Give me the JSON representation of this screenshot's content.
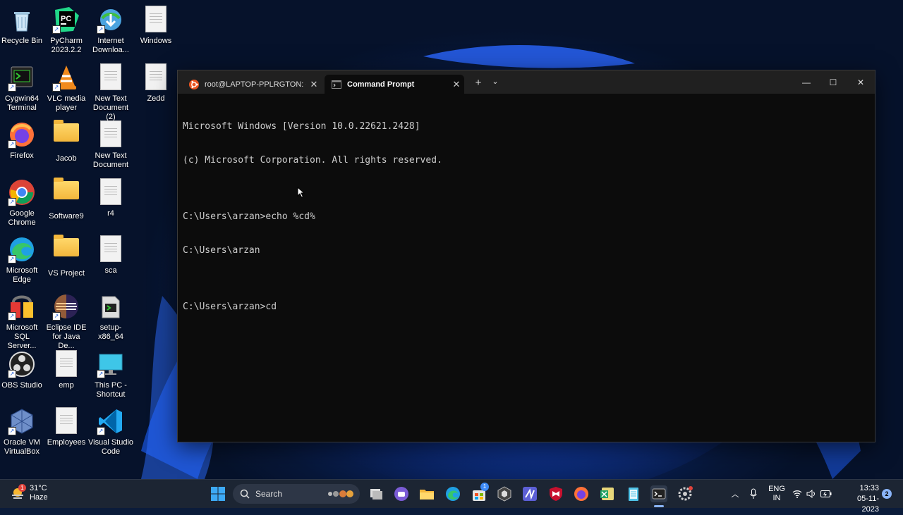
{
  "desktop": {
    "icons": [
      {
        "label": "Recycle Bin",
        "icon": "recycle-bin-icon"
      },
      {
        "label": "PyCharm 2023.2.2",
        "icon": "pycharm-icon"
      },
      {
        "label": "Internet Downloa...",
        "icon": "internet-download-manager-icon"
      },
      {
        "label": "Windows",
        "icon": "text-document-icon"
      },
      {
        "label": "Cygwin64 Terminal",
        "icon": "cygwin-icon"
      },
      {
        "label": "VLC media player",
        "icon": "vlc-icon"
      },
      {
        "label": "New Text Document (2)",
        "icon": "text-document-icon"
      },
      {
        "label": "Zedd",
        "icon": "text-document-icon"
      },
      {
        "label": "Firefox",
        "icon": "firefox-icon"
      },
      {
        "label": "Jacob",
        "icon": "folder-icon"
      },
      {
        "label": "New Text Document",
        "icon": "text-document-icon"
      },
      {
        "label": "Google Chrome",
        "icon": "chrome-icon"
      },
      {
        "label": "Software9",
        "icon": "folder-icon"
      },
      {
        "label": "r4",
        "icon": "text-document-icon"
      },
      {
        "label": "Microsoft Edge",
        "icon": "edge-icon"
      },
      {
        "label": "VS Project",
        "icon": "folder-icon"
      },
      {
        "label": "sca",
        "icon": "text-document-icon"
      },
      {
        "label": "Microsoft SQL Server...",
        "icon": "sql-server-icon"
      },
      {
        "label": "Eclipse IDE for Java De...",
        "icon": "eclipse-icon"
      },
      {
        "label": "setup-x86_64",
        "icon": "installer-icon"
      },
      {
        "label": "OBS Studio",
        "icon": "obs-icon"
      },
      {
        "label": "emp",
        "icon": "text-document-icon"
      },
      {
        "label": "This PC - Shortcut",
        "icon": "monitor-icon"
      },
      {
        "label": "Oracle VM VirtualBox",
        "icon": "virtualbox-icon"
      },
      {
        "label": "Employees",
        "icon": "text-document-icon"
      },
      {
        "label": "Visual Studio Code",
        "icon": "vscode-icon"
      }
    ]
  },
  "terminal": {
    "tabs": [
      {
        "title": "root@LAPTOP-PPLRGTON: ~",
        "icon": "ubuntu-icon",
        "active": false
      },
      {
        "title": "Command Prompt",
        "icon": "cmd-icon",
        "active": true
      }
    ],
    "new_tab_label": "+",
    "dropdown_label": "⌄",
    "controls": {
      "minimize": "—",
      "maximize": "☐",
      "close": "✕"
    },
    "lines": [
      "Microsoft Windows [Version 10.0.22621.2428]",
      "(c) Microsoft Corporation. All rights reserved.",
      "",
      "C:\\Users\\arzan>echo %cd%",
      "C:\\Users\\arzan",
      "",
      "C:\\Users\\arzan>cd"
    ]
  },
  "taskbar": {
    "weather": {
      "temp": "31°C",
      "condition": "Haze",
      "badge": "1"
    },
    "search_placeholder": "Search",
    "apps": [
      "start-icon",
      "search",
      "task-view-icon",
      "teams-chat-icon",
      "file-explorer-icon",
      "edge-icon",
      "store-icon",
      "cube-app-icon",
      "visual-studio-icon",
      "mcafee-icon",
      "firefox-icon",
      "excel-icon",
      "notepad-icon",
      "terminal-icon",
      "settings-icon"
    ],
    "store_badge": "1",
    "tray": {
      "language_line1": "ENG",
      "language_line2": "IN",
      "time": "13:33",
      "date": "05-11-2023",
      "notifications": "2"
    }
  },
  "colors": {
    "console_bg": "#0c0c0c",
    "console_text": "#cccccc",
    "titlebar": "#202020",
    "taskbar": "#1c2533"
  }
}
